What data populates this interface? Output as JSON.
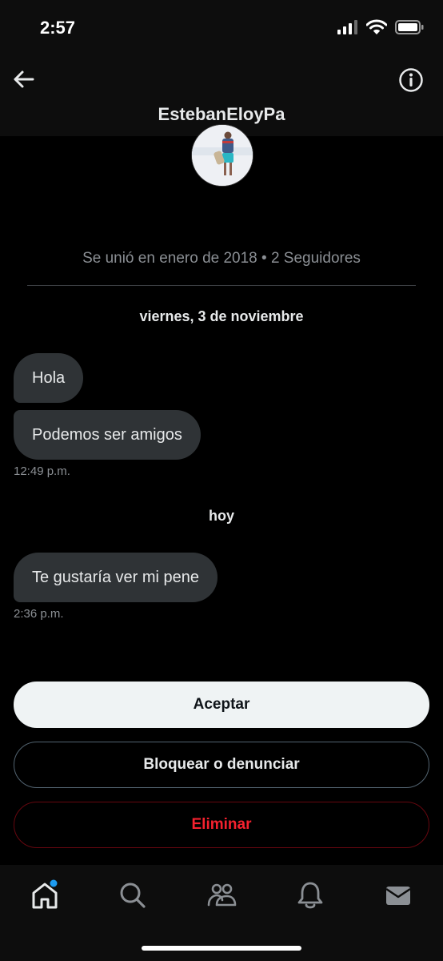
{
  "status": {
    "time": "2:57"
  },
  "header": {
    "username": "EstebanEloyPa"
  },
  "profile": {
    "joined_text": "Se unió en enero de 2018 • 2 Seguidores"
  },
  "conversation": {
    "date_1": "viernes, 3 de noviembre",
    "messages_1": [
      "Hola",
      "Podemos ser amigos"
    ],
    "timestamp_1": "12:49 p.m.",
    "date_2": "hoy",
    "messages_2": [
      "Te gustaría ver mi pene"
    ],
    "timestamp_2": "2:36 p.m."
  },
  "actions": {
    "accept_label": "Aceptar",
    "block_label": "Bloquear o denunciar",
    "delete_label": "Eliminar"
  },
  "tabbar": {
    "items": [
      "home-icon",
      "search-icon",
      "communities-icon",
      "notifications-icon",
      "messages-icon"
    ],
    "accent": "#1d9bf0"
  },
  "colors": {
    "delete": "#f4212e",
    "bubble": "#2f3336"
  }
}
